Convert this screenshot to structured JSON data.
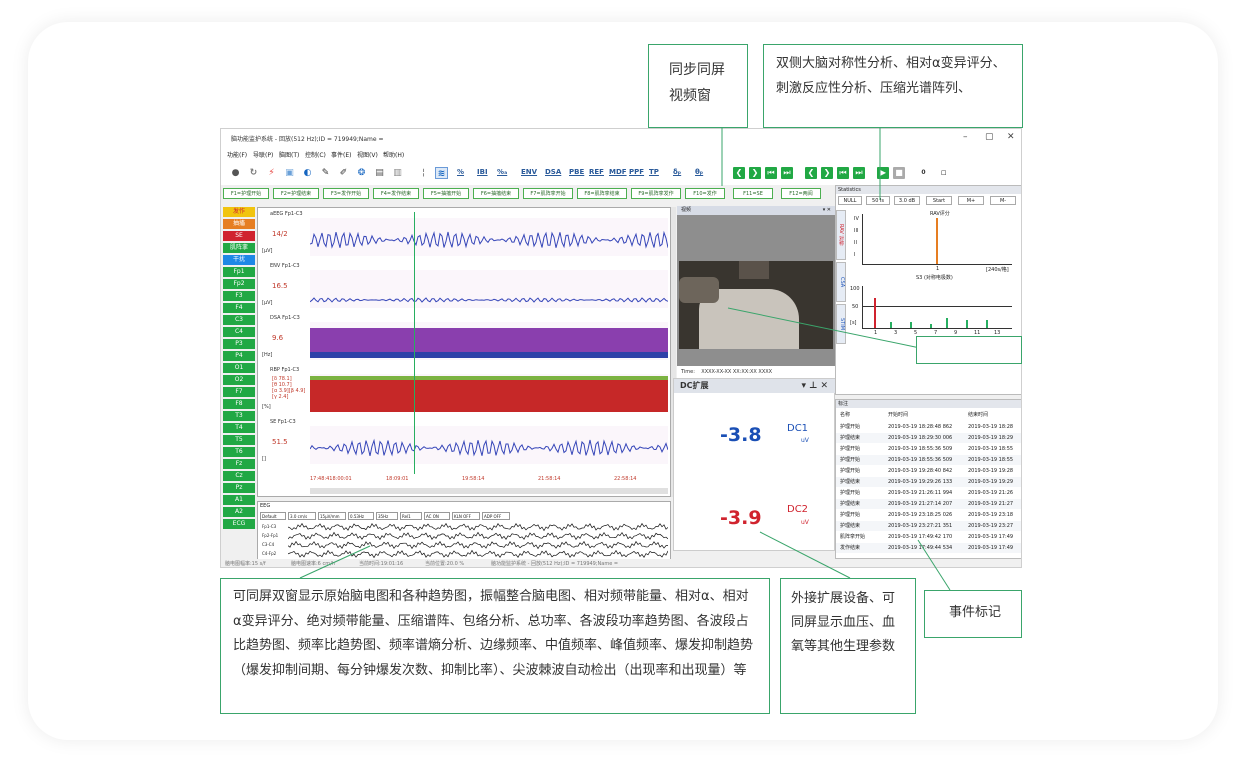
{
  "window": {
    "title": "脑功能监护系统 - 回放(512 Hz);ID = 719949;Name = ",
    "controls": [
      "–",
      "▢",
      "✕"
    ]
  },
  "menu": [
    "功能(F)",
    "导联(P)",
    "脑图(T)",
    "控制(C)",
    "事件(E)",
    "视图(V)",
    "帮助(H)"
  ],
  "toolbar": {
    "text_buttons": [
      "%",
      "IBI",
      "%ₐ",
      "ENV",
      "DSA",
      "PBE",
      "REF",
      "MDF",
      "PPF",
      "TP",
      "δₚ",
      "θₚ"
    ],
    "nav_count": "0"
  },
  "fkeys": [
    "F1=护理开始",
    "F2=护理结束",
    "F3=发作开始",
    "F4=发作结束",
    "F5=抽搐开始",
    "F6=抽搐结束",
    "F7=肌阵挛开始",
    "F8=肌阵挛结束",
    "F9=肌阵挛发作",
    "F10=发作",
    "F11=SE",
    "F12=两阅"
  ],
  "left_buttons": [
    "发作",
    "抽搐",
    "SE",
    "肌阵挛",
    "干扰",
    "Fp1",
    "Fp2",
    "F3",
    "F4",
    "C3",
    "C4",
    "P3",
    "P4",
    "O1",
    "O2",
    "F7",
    "F8",
    "T3",
    "T4",
    "T5",
    "T6",
    "Fz",
    "Cz",
    "Pz",
    "A1",
    "A2",
    "ECG"
  ],
  "trends": [
    {
      "name": "aEEG Fp1-C3",
      "value": "14/2",
      "unit": "[µV]",
      "color": "#2b3fb0"
    },
    {
      "name": "ENV Fp1-C3",
      "value": "16.5",
      "unit": "[µV]",
      "color": "#2b3fb0"
    },
    {
      "name": "DSA Fp1-C3",
      "value": "9.6",
      "unit": "[Hz]",
      "color": "#9a3fb0"
    },
    {
      "name": "RBP Fp1-C3",
      "value": "[δ 78.1]\n[θ 10.7]\n[α 3.9][β 4.9]\n[γ 2.4]",
      "unit": "[%]",
      "color": "#c62828"
    },
    {
      "name": "SE Fp1-C3",
      "value": "51.5",
      "unit": "[]",
      "color": "#2b3fb0"
    }
  ],
  "timeline": [
    "17:48:418:00:01",
    "18:09:01",
    "19:58:14",
    "21:58:14",
    "22:58:14"
  ],
  "eeg": {
    "title": "EEG",
    "controls": [
      "Default",
      "3.0 cm/s",
      "15µV/mm",
      "0.53Hz",
      "35Hz",
      "Rel1",
      "AC ON",
      "KLN OFF",
      "ADP OFF"
    ],
    "channels": [
      "Fp1-C3",
      "Fp2-Fp1",
      "C3-C4",
      "C4-Fp2"
    ]
  },
  "video": {
    "header": "视频",
    "time_label": "Time:",
    "time_value": "XXXX-XX-XX XX:XX:XX XXXX"
  },
  "dc": {
    "title": "DC扩展",
    "ch1_value": "-3.8",
    "ch1_label": "DC1",
    "ch1_unit": "uV",
    "ch2_value": "-3.9",
    "ch2_label": "DC2",
    "ch2_unit": "uV"
  },
  "statistics": {
    "header": "Statistics",
    "buttons": [
      "NULL",
      "50 ls",
      "3.0 dB",
      "Start",
      "M+",
      "M-"
    ],
    "tabs": [
      "RAV 对称",
      "CSA",
      "STIM"
    ],
    "bar_chart_title": "RAV评分",
    "yaxis_labels": [
      "IV",
      "III",
      "II",
      "I"
    ],
    "xaxis_label": "S3 (对称电极数)",
    "x_tick": "1",
    "range_label": "[240s/格]",
    "stim_yaxis": [
      "100",
      "50",
      "[s]"
    ],
    "stim_xticks": [
      "1",
      "3",
      "5",
      "7",
      "9",
      "11",
      "13"
    ]
  },
  "events": {
    "header": "标注",
    "columns": [
      "名称",
      "开始时间",
      "结束时间"
    ],
    "rows": [
      [
        "护理开始",
        "2019-03-19 18:28:48 862",
        "2019-03-19 18:28"
      ],
      [
        "护理结束",
        "2019-03-19 18:29:30 006",
        "2019-03-19 18:29"
      ],
      [
        "护理开始",
        "2019-03-19 18:55:36 509",
        "2019-03-19 18:55"
      ],
      [
        "护理开始",
        "2019-03-19 18:55:36 509",
        "2019-03-19 18:55"
      ],
      [
        "护理开始",
        "2019-03-19 19:28:40 842",
        "2019-03-19 19:28"
      ],
      [
        "护理结束",
        "2019-03-19 19:29:26 133",
        "2019-03-19 19:29"
      ],
      [
        "护理开始",
        "2019-03-19 21:26:11 994",
        "2019-03-19 21:26"
      ],
      [
        "护理结束",
        "2019-03-19 21:27:14 207",
        "2019-03-19 21:27"
      ],
      [
        "护理开始",
        "2019-03-19 23:18:25 026",
        "2019-03-19 23:18"
      ],
      [
        "护理结束",
        "2019-03-19 23:27:21 351",
        "2019-03-19 23:27"
      ],
      [
        "肌阵挛开始",
        "2019-03-19 17:49:42 170",
        "2019-03-19 17:49"
      ],
      [
        "发作结束",
        "2019-03-19 17:49:44 534",
        "2019-03-19 17:49"
      ]
    ]
  },
  "statusbar": [
    "脑电图幅率:15 s/f",
    "脑电图速率:6 cm/h",
    "当前时间:19:01:16",
    "当前位置:20.0 %",
    "脑功能监护系统 - 回放(512 Hz);ID = 719949;Name ="
  ],
  "callouts": {
    "video": "同步同屏\n视频窗",
    "analysis": "双侧大脑对称性分析、相对α变异评分、刺激反应性分析、压缩光谱阵列、",
    "trends": "可同屏双窗显示原始脑电图和各种趋势图，振幅整合脑电图、相对频带能量、相对α、相对α变异评分、绝对频带能量、压缩谱阵、包络分析、总功率、各波段功率趋势图、各波段占比趋势图、频率比趋势图、频率谱熵分析、边缘频率、中值频率、峰值频率、爆发抑制趋势（爆发抑制间期、每分钟爆发次数、抑制比率）、尖波棘波自动检出（出现率和出现量）等",
    "device": "外接扩展设备、可同屏显示血压、血氧等其他生理参数",
    "event": "事件标记"
  }
}
